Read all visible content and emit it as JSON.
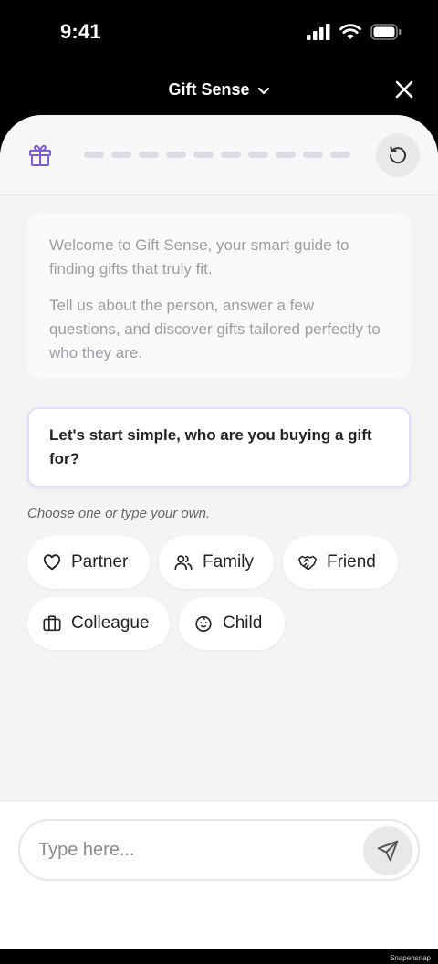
{
  "status": {
    "time": "9:41"
  },
  "header": {
    "title": "Gift Sense"
  },
  "progress": {
    "steps_total": 10,
    "steps_done": 0
  },
  "welcome": {
    "p1": "Welcome to Gift Sense, your smart guide to finding gifts that truly fit.",
    "p2": "Tell us about the person, answer a few questions, and discover gifts tailored perfectly to who they are."
  },
  "question": {
    "text": "Let's start simple, who are you buying a gift for?"
  },
  "hint": "Choose one or type your own.",
  "chips": [
    {
      "label": "Partner",
      "icon": "heart-icon"
    },
    {
      "label": "Family",
      "icon": "users-icon"
    },
    {
      "label": "Friend",
      "icon": "handshake-icon"
    },
    {
      "label": "Colleague",
      "icon": "briefcase-icon"
    },
    {
      "label": "Child",
      "icon": "baby-icon"
    }
  ],
  "composer": {
    "placeholder": "Type here..."
  },
  "watermark": "Snapensnap",
  "colors": {
    "accent": "#7c5ce0",
    "progress_track": "#dcdce6"
  }
}
